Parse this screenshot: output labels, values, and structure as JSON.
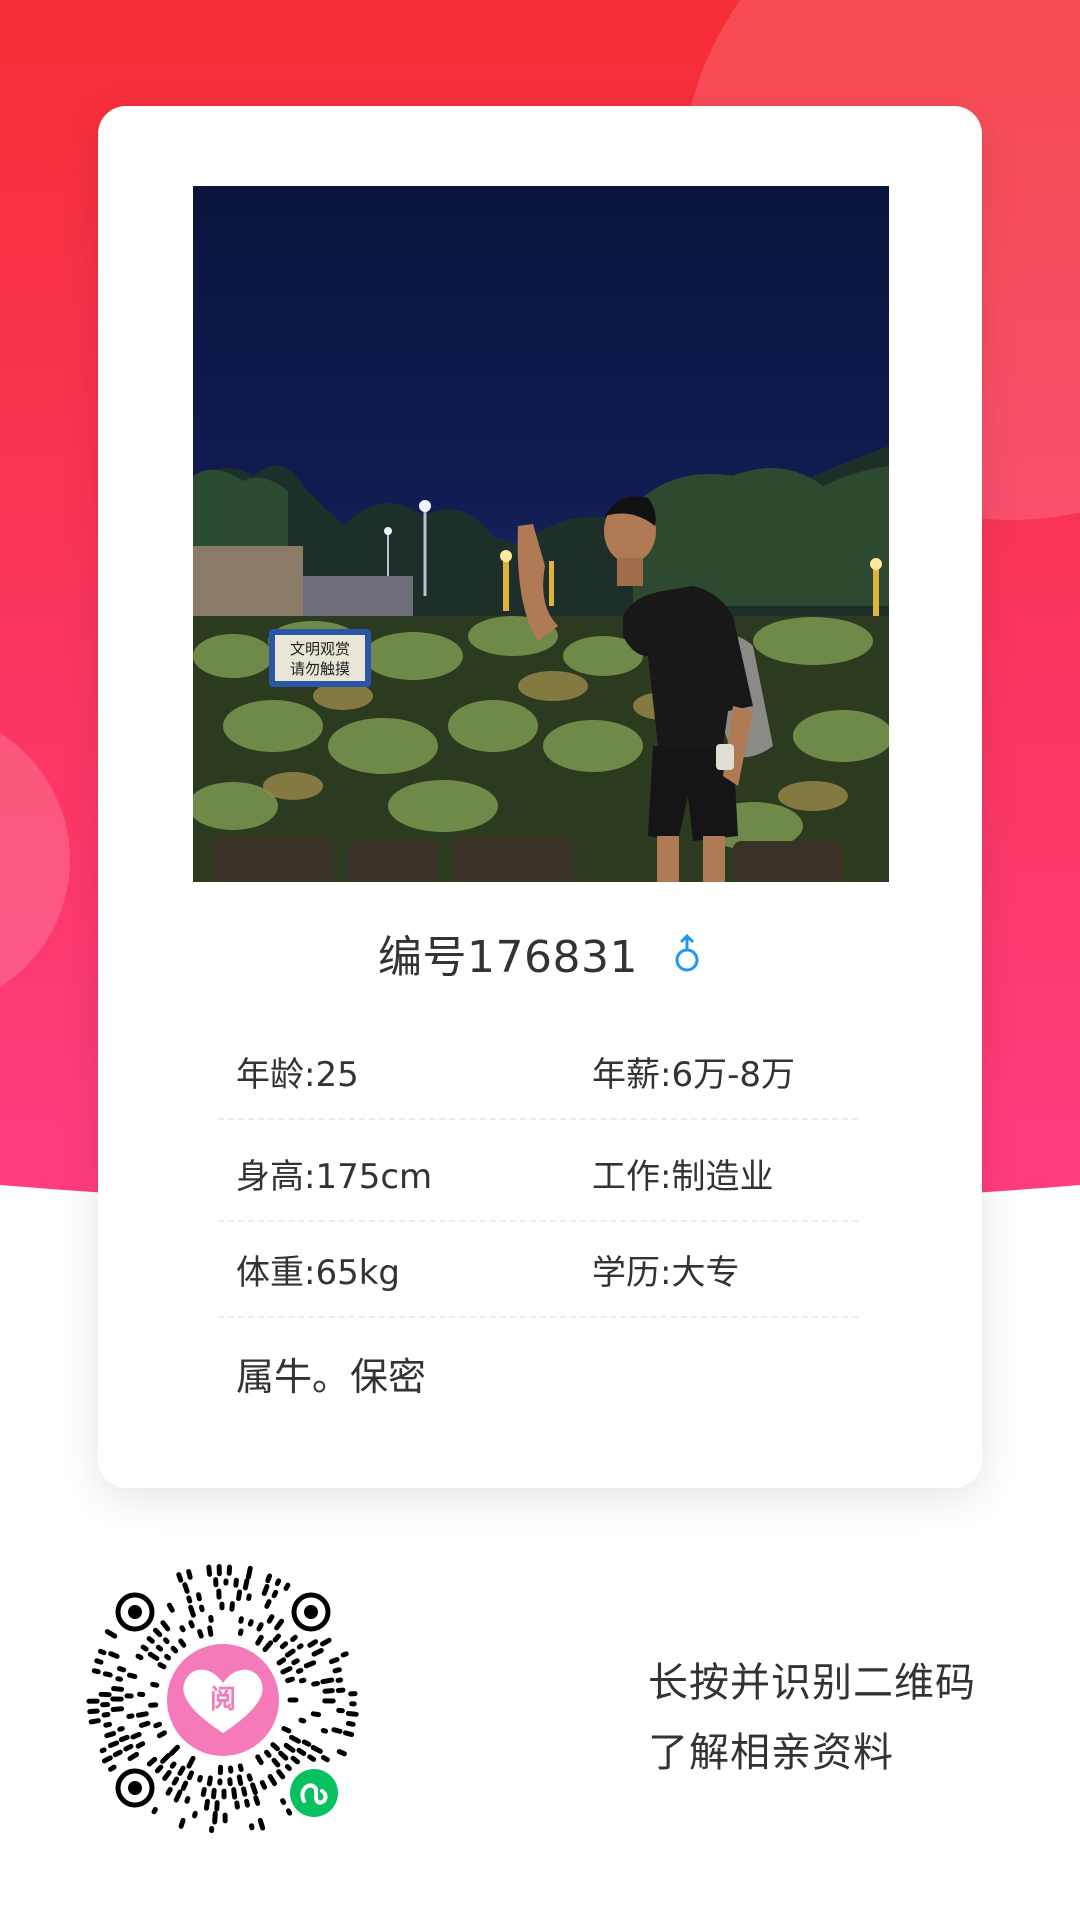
{
  "profile": {
    "name": "编号176831",
    "gender_icon": "male-symbol-icon",
    "gender_color": "#2196f3",
    "photo_sign_line1": "文明观赏",
    "photo_sign_line2": "请勿触摸"
  },
  "info": {
    "age": "年龄:25",
    "salary": "年薪:6万-8万",
    "height": "身高:175cm",
    "job": "工作:制造业",
    "weight": "体重:65kg",
    "education": "学历:大专"
  },
  "bio": "属牛。保密",
  "qr": {
    "line1": "长按并识别二维码",
    "line2": "了解相亲资料",
    "center_icon": "heart-logo-icon",
    "badge_icon": "mini-program-icon"
  },
  "colors": {
    "bg_top": "#f6303a",
    "bg_bottom": "#ff3d7f",
    "accent_pink": "#f57ab9",
    "badge_green": "#07c160"
  }
}
